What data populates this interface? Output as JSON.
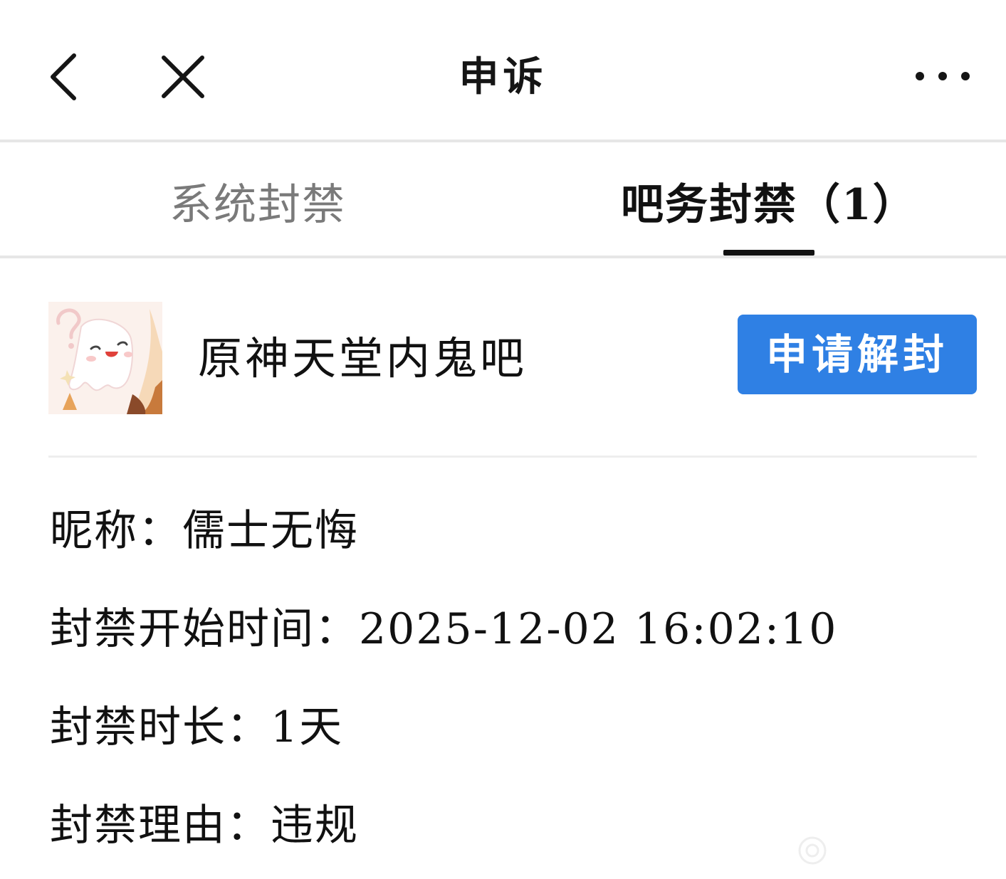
{
  "header": {
    "title": "申诉",
    "icons": {
      "back": "chevron-left-icon",
      "close": "close-icon",
      "more": "more-dots-icon"
    }
  },
  "tabs": [
    {
      "label": "系统封禁",
      "active": false
    },
    {
      "label": "吧务封禁（1）",
      "active": true
    }
  ],
  "ban_card": {
    "forum_name": "原神天堂内鬼吧",
    "appeal_button": "申请解封",
    "avatar_icon": "ghost-mascot-icon"
  },
  "details": {
    "nickname_label": "昵称：",
    "nickname": "儒士无悔",
    "start_label": "封禁开始时间：",
    "start_time": "2025-12-02 16:02:10",
    "duration_label": "封禁时长：",
    "duration": "1天",
    "reason_label": "封禁理由：",
    "reason": "违规"
  },
  "colors": {
    "accent": "#2f80e4",
    "tab_inactive": "#7a7a7a",
    "text": "#111111",
    "divider": "#e6e6e6"
  }
}
